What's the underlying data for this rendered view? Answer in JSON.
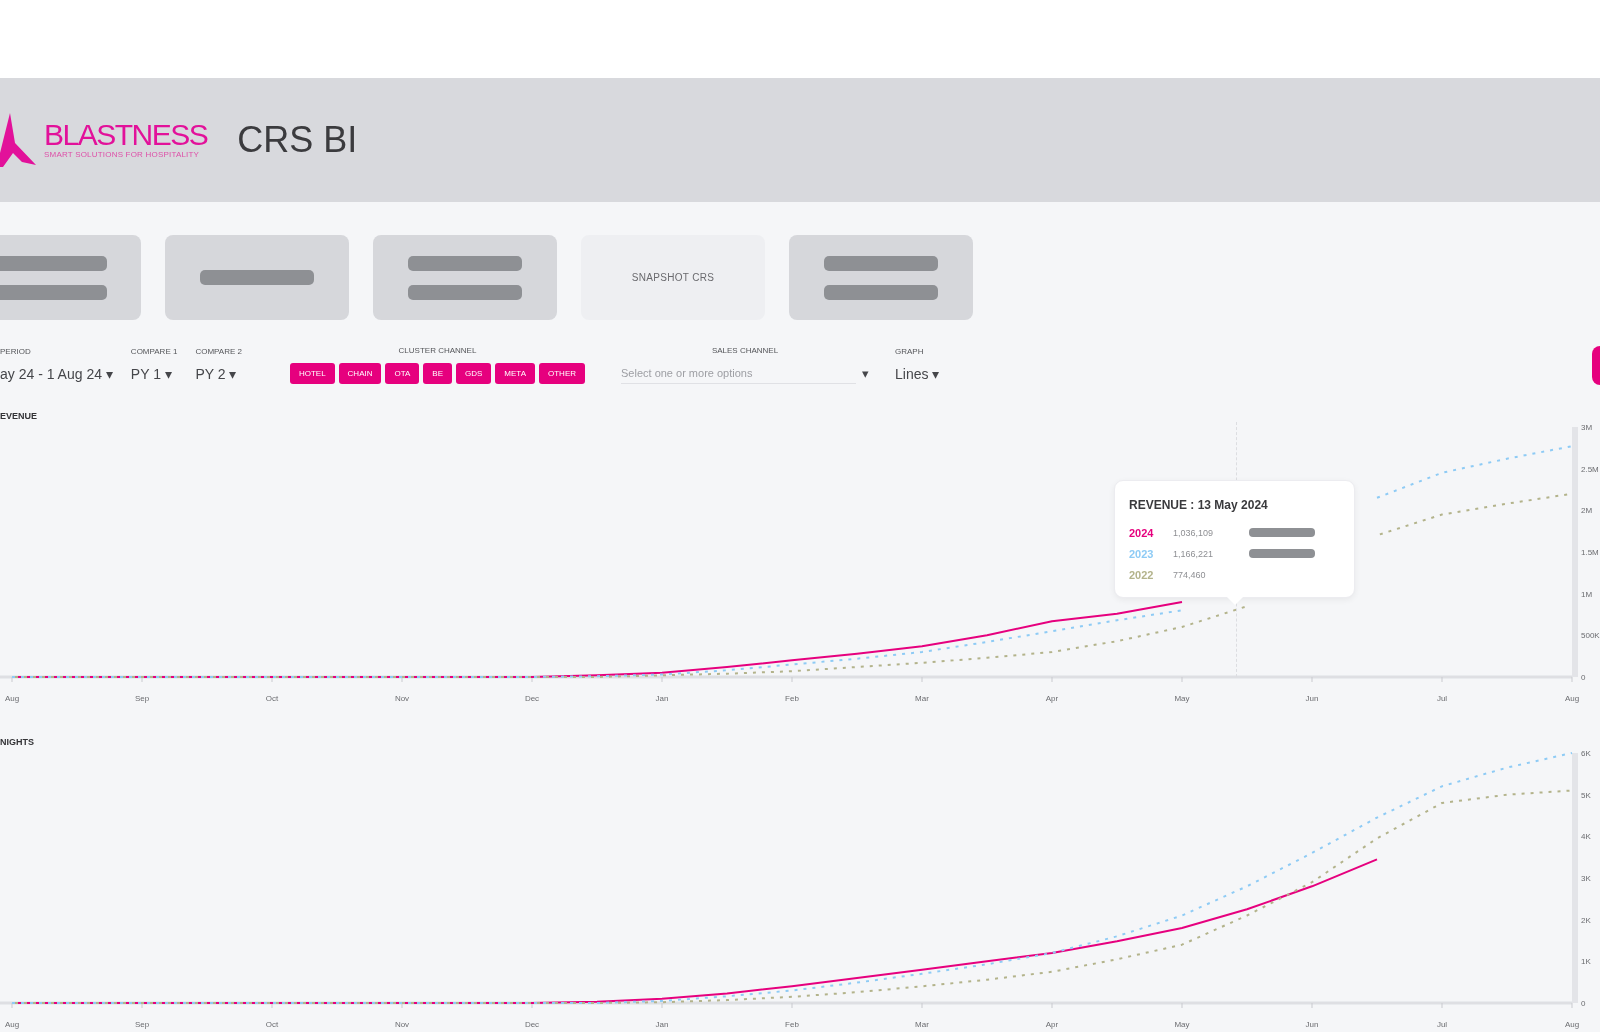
{
  "header": {
    "logo": {
      "name": "BLASTNESS",
      "tagline": "SMART SOLUTIONS FOR HOSPITALITY"
    },
    "title": "CRS BI"
  },
  "buttons": [
    {
      "kind": "redacted-double"
    },
    {
      "kind": "redacted-single"
    },
    {
      "kind": "redacted-double"
    },
    {
      "kind": "text",
      "label": "SNAPSHOT CRS"
    },
    {
      "kind": "redacted-double"
    }
  ],
  "filters": [
    {
      "kind": "dropdown",
      "label": "PERIOD",
      "value": "ay 24 - 1 Aug 24",
      "caret": "▾"
    },
    {
      "kind": "dropdown",
      "label": "COMPARE 1",
      "value": "PY 1",
      "caret": "▾"
    },
    {
      "kind": "dropdown",
      "label": "COMPARE 2",
      "value": "PY 2",
      "caret": "▾"
    },
    {
      "kind": "chips",
      "label": "CLUSTER CHANNEL",
      "chips": [
        "HOTEL",
        "CHAIN",
        "OTA",
        "BE",
        "GDS",
        "META",
        "OTHER"
      ]
    },
    {
      "kind": "select",
      "label": "SALES CHANNEL",
      "placeholder": "Select one or more options",
      "caret": "▾"
    },
    {
      "kind": "dropdown",
      "label": "GRAPH",
      "value": "Lines",
      "caret": "▾"
    }
  ],
  "charts": [
    {
      "title": "EVENUE",
      "chart_data": [
        {
          "type": "line",
          "categories": [
            "Aug",
            null,
            "Sep",
            null,
            "Oct",
            null,
            "Nov",
            null,
            "Dec",
            null,
            "Jan",
            null,
            "Feb",
            null,
            "Mar",
            null,
            "Apr",
            null,
            "May",
            null,
            "Jun",
            null,
            "Jul",
            null,
            "Aug"
          ],
          "ylim": [
            0,
            3000000
          ],
          "yticks": [
            {
              "value": 0,
              "label": "0"
            },
            {
              "value": 500000,
              "label": "500K"
            },
            {
              "value": 1000000,
              "label": "1M"
            },
            {
              "value": 1500000,
              "label": "1.5M"
            },
            {
              "value": 2000000,
              "label": "2M"
            },
            {
              "value": 2500000,
              "label": "2.5M"
            },
            {
              "value": 3000000,
              "label": "3M"
            }
          ],
          "series": [
            {
              "color": "#e6007e",
              "line_style": "solid",
              "values": [
                0,
                0,
                0,
                0,
                0,
                0,
                0,
                0,
                0,
                20000,
                50000,
                120000,
                200000,
                280000,
                370000,
                500000,
                670000,
                760000,
                900000,
                null,
                null,
                null,
                null,
                null,
                null
              ]
            },
            {
              "color": "#8ecbf5",
              "line_style": "dashed",
              "values": [
                0,
                0,
                0,
                0,
                0,
                0,
                0,
                0,
                0,
                10000,
                30000,
                80000,
                150000,
                220000,
                300000,
                420000,
                550000,
                680000,
                800000,
                null,
                null,
                2150000,
                2450000,
                2620000,
                2770000
              ]
            },
            {
              "color": "#b3b38b",
              "line_style": "dashed",
              "values": [
                0,
                0,
                0,
                0,
                0,
                0,
                0,
                0,
                0,
                0,
                20000,
                40000,
                70000,
                120000,
                170000,
                230000,
                300000,
                430000,
                600000,
                850000,
                null,
                1700000,
                1950000,
                2080000,
                2200000
              ]
            }
          ]
        }
      ],
      "tooltip": {
        "title": "REVENUE : 13 May 2024",
        "rows": [
          {
            "label": "2024",
            "value": "1,036,109",
            "color": "#e6007e",
            "redacted": true
          },
          {
            "label": "2023",
            "value": "1,166,221",
            "color": "#8ecbf5",
            "redacted": true
          },
          {
            "label": "2022",
            "value": "774,460",
            "color": "#b3b38b",
            "redacted": false
          }
        ]
      }
    },
    {
      "title": "NIGHTS",
      "chart_data": [
        {
          "type": "line",
          "categories": [
            "Aug",
            null,
            "Sep",
            null,
            "Oct",
            null,
            "Nov",
            null,
            "Dec",
            null,
            "Jan",
            null,
            "Feb",
            null,
            "Mar",
            null,
            "Apr",
            null,
            "May",
            null,
            "Jun",
            null,
            "Jul",
            null,
            "Aug"
          ],
          "ylim": [
            0,
            6000
          ],
          "yticks": [
            {
              "value": 0,
              "label": "0"
            },
            {
              "value": 1000,
              "label": "1K"
            },
            {
              "value": 2000,
              "label": "2K"
            },
            {
              "value": 3000,
              "label": "3K"
            },
            {
              "value": 4000,
              "label": "4K"
            },
            {
              "value": 5000,
              "label": "5K"
            },
            {
              "value": 6000,
              "label": "6K"
            }
          ],
          "series": [
            {
              "color": "#e6007e",
              "line_style": "solid",
              "values": [
                0,
                0,
                0,
                0,
                0,
                0,
                0,
                0,
                0,
                30,
                100,
                230,
                400,
                600,
                800,
                1000,
                1200,
                1480,
                1800,
                2250,
                2800,
                3450,
                null,
                null,
                null
              ]
            },
            {
              "color": "#8ecbf5",
              "line_style": "dashed",
              "values": [
                0,
                0,
                0,
                0,
                0,
                0,
                0,
                0,
                0,
                0,
                50,
                160,
                300,
                490,
                700,
                930,
                1200,
                1600,
                2100,
                2800,
                3600,
                4450,
                5200,
                5650,
                6000
              ]
            },
            {
              "color": "#b3b38b",
              "line_style": "dashed",
              "values": [
                0,
                0,
                0,
                0,
                0,
                0,
                0,
                0,
                0,
                0,
                20,
                70,
                150,
                260,
                400,
                560,
                750,
                1050,
                1400,
                2100,
                2900,
                3950,
                4800,
                5000,
                5100
              ]
            }
          ]
        }
      ]
    }
  ]
}
